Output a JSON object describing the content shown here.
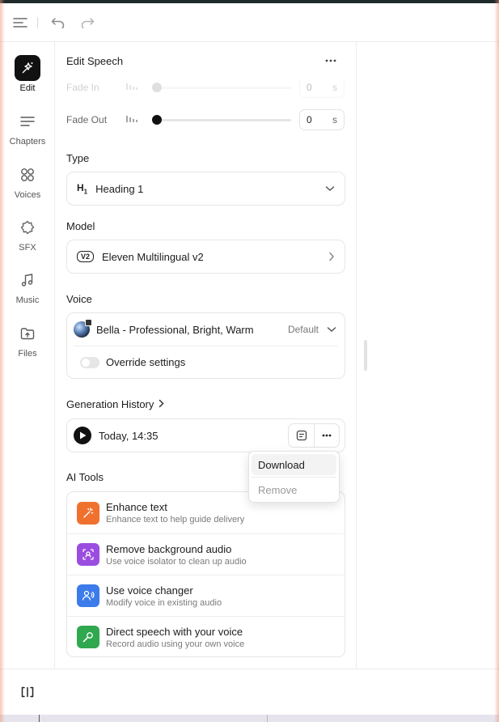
{
  "panel": {
    "title": "Edit Speech"
  },
  "nav": [
    {
      "label": "Edit",
      "icon": "edit-sparkle-icon"
    },
    {
      "label": "Chapters",
      "icon": "chapters-icon"
    },
    {
      "label": "Voices",
      "icon": "voices-icon"
    },
    {
      "label": "SFX",
      "icon": "sfx-icon"
    },
    {
      "label": "Music",
      "icon": "music-note-icon"
    },
    {
      "label": "Files",
      "icon": "files-icon"
    }
  ],
  "fade_in": {
    "label": "Fade In",
    "value": "0",
    "unit": "s",
    "level": 0
  },
  "fade_out": {
    "label": "Fade Out",
    "value": "0",
    "unit": "s",
    "level": 0
  },
  "type": {
    "label": "Type",
    "prefix": "H",
    "prefix_sub": "1",
    "value": "Heading 1"
  },
  "model": {
    "label": "Model",
    "badge": "V2",
    "value": "Eleven Multilingual v2"
  },
  "voice": {
    "label": "Voice",
    "name": "Bella - Professional, Bright, Warm",
    "tag": "Default",
    "override_label": "Override settings",
    "override_on": false
  },
  "generation": {
    "label": "Generation History",
    "time": "Today, 14:35"
  },
  "menu": {
    "download": "Download",
    "remove": "Remove"
  },
  "ai_tools": {
    "label": "AI Tools",
    "items": [
      {
        "name": "Enhance text",
        "desc": "Enhance text to help guide delivery",
        "color": "#f0702e",
        "icon": "magic-wand-icon"
      },
      {
        "name": "Remove background audio",
        "desc": "Use voice isolator to clean up audio",
        "color": "#9b4de0",
        "icon": "voice-isolator-icon"
      },
      {
        "name": "Use voice changer",
        "desc": "Modify voice in existing audio",
        "color": "#3b7bea",
        "icon": "voice-changer-icon"
      },
      {
        "name": "Direct speech with your voice",
        "desc": "Record audio using your own voice",
        "color": "#2fa84f",
        "icon": "microphone-icon"
      }
    ]
  }
}
